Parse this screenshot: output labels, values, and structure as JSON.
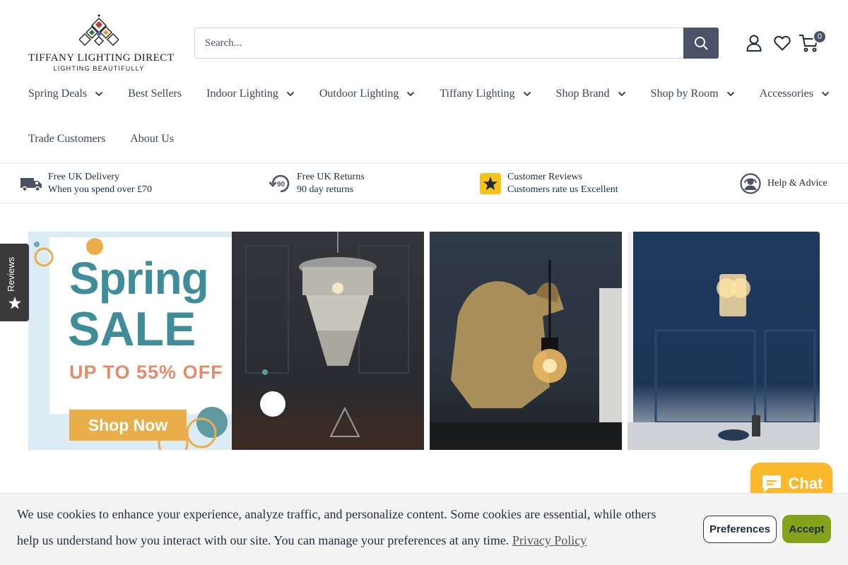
{
  "logo": {
    "title": "TIFFANY LIGHTING DIRECT",
    "subtitle": "LIGHTING BEAUTIFULLY"
  },
  "search": {
    "placeholder": "Search..."
  },
  "header_icons": {
    "account": "user-icon",
    "wishlist": "heart-icon",
    "cart": "cart-icon",
    "cart_count": "0"
  },
  "nav": {
    "row1": [
      {
        "label": "Spring Deals",
        "has_dropdown": true
      },
      {
        "label": "Best Sellers",
        "has_dropdown": false
      },
      {
        "label": "Indoor Lighting",
        "has_dropdown": true
      },
      {
        "label": "Outdoor Lighting",
        "has_dropdown": true
      },
      {
        "label": "Tiffany Lighting",
        "has_dropdown": true
      },
      {
        "label": "Shop Brand",
        "has_dropdown": true
      },
      {
        "label": "Shop by Room",
        "has_dropdown": true
      },
      {
        "label": "Accessories",
        "has_dropdown": true
      }
    ],
    "row2": [
      {
        "label": "Trade Customers",
        "has_dropdown": false
      },
      {
        "label": "About Us",
        "has_dropdown": false
      }
    ]
  },
  "benefits": [
    {
      "icon": "delivery-truck-icon",
      "line1": "Free UK Delivery",
      "line2": "When you spend over £70"
    },
    {
      "icon": "returns-90-icon",
      "line1": "Free UK Returns",
      "line2": "90 day returns"
    },
    {
      "icon": "star-rating-icon",
      "line1": "Customer Reviews",
      "line2": "Customers rate us Excellent"
    },
    {
      "icon": "support-agent-icon",
      "line1": "Help & Advice",
      "line2": ""
    }
  ],
  "banner": {
    "heading1": "Spring",
    "heading2": "SALE",
    "offer": "UP TO 55% OFF",
    "cta": "Shop Now"
  },
  "reviews_tab": {
    "label": "Reviews"
  },
  "chat": {
    "label": "Chat"
  },
  "cookie": {
    "text": "We use cookies to enhance your experience, analyze traffic, and personalize content. Some cookies are essential, while others help us understand how you interact with our site. You can manage your preferences at any time.",
    "link": "Privacy Policy",
    "preferences": "Preferences",
    "accept": "Accept"
  },
  "colors": {
    "brand_dark": "#4b5166",
    "accept_green": "#84a21a",
    "chat_yellow": "#f9b92a",
    "sale_teal": "#3e8d99",
    "sale_orange": "#e28c6b",
    "cta_gold": "#e9ad49"
  }
}
